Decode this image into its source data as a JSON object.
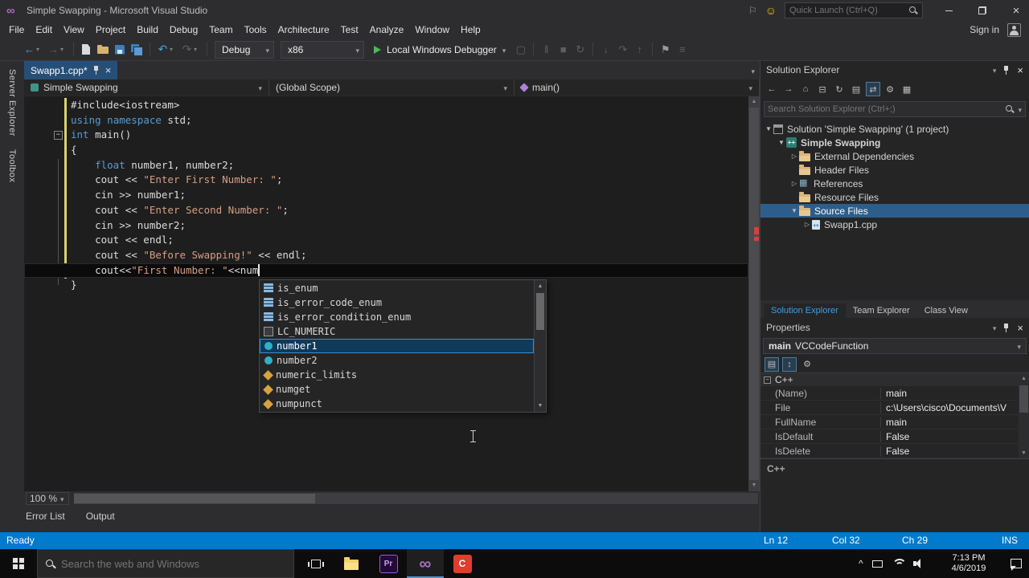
{
  "titlebar": {
    "title": "Simple Swapping - Microsoft Visual Studio",
    "quick_launch": "Quick Launch (Ctrl+Q)"
  },
  "menubar": {
    "items": [
      "File",
      "Edit",
      "View",
      "Project",
      "Build",
      "Debug",
      "Team",
      "Tools",
      "Architecture",
      "Test",
      "Analyze",
      "Window",
      "Help"
    ],
    "sign_in": "Sign in"
  },
  "toolbar": {
    "config": "Debug",
    "platform": "x86",
    "run": "Local Windows Debugger",
    "left_icons": [
      {
        "name": "nav-backward-icon",
        "shape": "back",
        "dd": true
      },
      {
        "name": "nav-forward-icon",
        "shape": "fwd",
        "dd": true
      },
      {
        "sep": true
      },
      {
        "name": "new-file-icon",
        "shape": "newfile"
      },
      {
        "name": "open-file-icon",
        "shape": "openfolder"
      },
      {
        "name": "save-icon",
        "shape": "save"
      },
      {
        "name": "save-all-icon",
        "shape": "saveall"
      },
      {
        "sep": true
      },
      {
        "name": "undo-icon",
        "shape": "undo",
        "dd": true
      },
      {
        "name": "redo-icon",
        "shape": "redo",
        "dd": true
      },
      {
        "sep": true
      }
    ],
    "right_icons": [
      {
        "name": "breakpoints-window-icon",
        "shape": "window"
      },
      {
        "sep": true
      },
      {
        "name": "pause-icon",
        "shape": "pause"
      },
      {
        "name": "stop-icon",
        "shape": "stop"
      },
      {
        "name": "restart-icon",
        "shape": "restart"
      },
      {
        "sep": true
      },
      {
        "name": "step-into-icon",
        "shape": "stepin"
      },
      {
        "name": "step-over-icon",
        "shape": "stepover"
      },
      {
        "name": "step-out-icon",
        "shape": "stepout"
      },
      {
        "sep": true
      },
      {
        "name": "bookmark-icon",
        "shape": "flag"
      },
      {
        "name": "task-list-icon",
        "shape": "list"
      }
    ]
  },
  "side_strip": {
    "tabs": [
      "Server Explorer",
      "Toolbox"
    ]
  },
  "editor": {
    "tab": {
      "label": "Swapp1.cpp*"
    },
    "navbar": {
      "project": "Simple Swapping",
      "scope": "(Global Scope)",
      "member": "main()"
    },
    "zoom": "100 %",
    "panel_tabs": [
      "Error List",
      "Output"
    ],
    "code": [
      {
        "tokens": [
          {
            "c": "pl",
            "t": "#include<iostream>"
          }
        ]
      },
      {
        "tokens": [
          {
            "c": "kw",
            "t": "using"
          },
          {
            "c": "pl",
            "t": " "
          },
          {
            "c": "kw",
            "t": "namespace"
          },
          {
            "c": "pl",
            "t": " std;"
          }
        ]
      },
      {
        "fold": true,
        "tokens": [
          {
            "c": "kw",
            "t": "int"
          },
          {
            "c": "pl",
            "t": " main()"
          }
        ]
      },
      {
        "tokens": [
          {
            "c": "pl",
            "t": "{"
          }
        ]
      },
      {
        "tokens": [
          {
            "c": "pl",
            "t": "    "
          },
          {
            "c": "kw",
            "t": "float"
          },
          {
            "c": "pl",
            "t": " number1, number2;"
          }
        ]
      },
      {
        "tokens": [
          {
            "c": "pl",
            "t": "    cout << "
          },
          {
            "c": "str",
            "t": "\"Enter First Number: \""
          },
          {
            "c": "pl",
            "t": ";"
          }
        ]
      },
      {
        "tokens": [
          {
            "c": "pl",
            "t": "    cin >> number1;"
          }
        ]
      },
      {
        "tokens": [
          {
            "c": "pl",
            "t": "    cout << "
          },
          {
            "c": "str",
            "t": "\"Enter Second Number: \""
          },
          {
            "c": "pl",
            "t": ";"
          }
        ]
      },
      {
        "tokens": [
          {
            "c": "pl",
            "t": "    cin >> number2;"
          }
        ]
      },
      {
        "tokens": [
          {
            "c": "pl",
            "t": "    cout << endl;"
          }
        ]
      },
      {
        "tokens": [
          {
            "c": "pl",
            "t": "    cout << "
          },
          {
            "c": "str",
            "t": "\"Before Swapping!\""
          },
          {
            "c": "pl",
            "t": " << endl;"
          }
        ]
      },
      {
        "current": true,
        "caret": true,
        "tokens": [
          {
            "c": "pl",
            "t": "    cout<<"
          },
          {
            "c": "str",
            "t": "\"First Number: \""
          },
          {
            "c": "pl",
            "t": "<<num"
          }
        ]
      },
      {
        "tokens": [
          {
            "c": "pl",
            "t": "}"
          }
        ]
      }
    ]
  },
  "intellisense": {
    "items": [
      {
        "label": "is_enum",
        "kind": "struct"
      },
      {
        "label": "is_error_code_enum",
        "kind": "struct"
      },
      {
        "label": "is_error_condition_enum",
        "kind": "struct"
      },
      {
        "label": "LC_NUMERIC",
        "kind": "macro"
      },
      {
        "label": "number1",
        "kind": "field",
        "selected": true
      },
      {
        "label": "number2",
        "kind": "field"
      },
      {
        "label": "numeric_limits",
        "kind": "class"
      },
      {
        "label": "numget",
        "kind": "class"
      },
      {
        "label": "numpunct",
        "kind": "class"
      }
    ]
  },
  "solution_explorer": {
    "title": "Solution Explorer",
    "search_placeholder": "Search Solution Explorer (Ctrl+;)",
    "toolbar_icons": [
      {
        "name": "back-icon",
        "glyph": "←"
      },
      {
        "name": "forward-icon",
        "glyph": "→"
      },
      {
        "name": "home-icon",
        "glyph": "⌂"
      },
      {
        "name": "collapse-all-icon",
        "glyph": "⊟"
      },
      {
        "name": "refresh-icon",
        "glyph": "↻"
      },
      {
        "name": "show-all-files-icon",
        "glyph": "▤"
      },
      {
        "name": "sync-active-document-icon",
        "glyph": "⇄",
        "boxed": true
      },
      {
        "name": "properties-icon",
        "glyph": "⚙"
      },
      {
        "name": "preview-icon",
        "glyph": "▦"
      }
    ],
    "tree": [
      {
        "label": "Solution 'Simple Swapping' (1 project)",
        "level": 0,
        "arrow": "expanded",
        "icon": "solution"
      },
      {
        "label": "Simple Swapping",
        "level": 1,
        "arrow": "expanded",
        "icon": "cpp-project",
        "bold": true
      },
      {
        "label": "External Dependencies",
        "level": 2,
        "arrow": "collapsed",
        "icon": "folder"
      },
      {
        "label": "Header Files",
        "level": 2,
        "arrow": "none",
        "icon": "folder"
      },
      {
        "label": "References",
        "level": 2,
        "arrow": "collapsed",
        "icon": "references"
      },
      {
        "label": "Resource Files",
        "level": 2,
        "arrow": "none",
        "icon": "folder"
      },
      {
        "label": "Source Files",
        "level": 2,
        "arrow": "expanded",
        "icon": "folder",
        "selected": true
      },
      {
        "label": "Swapp1.cpp",
        "level": 3,
        "arrow": "collapsed",
        "icon": "cpp-file"
      }
    ],
    "bottom_tabs": [
      {
        "label": "Solution Explorer",
        "active": true
      },
      {
        "label": "Team Explorer"
      },
      {
        "label": "Class View"
      }
    ]
  },
  "properties": {
    "title": "Properties",
    "object_name": "main",
    "object_type": "VCCodeFunction",
    "toolbar_icons": [
      {
        "name": "categorized-icon",
        "glyph": "▤",
        "boxed": true
      },
      {
        "name": "alphabetical-icon",
        "glyph": "↕",
        "boxed": true
      },
      {
        "name": "property-pages-icon",
        "glyph": "⚙"
      }
    ],
    "category": "C++",
    "rows": [
      {
        "name": "(Name)",
        "value": "main"
      },
      {
        "name": "File",
        "value": "c:\\Users\\cisco\\Documents\\V"
      },
      {
        "name": "FullName",
        "value": "main"
      },
      {
        "name": "IsDefault",
        "value": "False"
      },
      {
        "name": "IsDelete",
        "value": "False"
      }
    ],
    "description_title": "C++"
  },
  "statusbar": {
    "ready": "Ready",
    "line": "Ln 12",
    "column": "Col 32",
    "character": "Ch 29",
    "mode": "INS"
  },
  "taskbar": {
    "search_placeholder": "Search the web and Windows",
    "apps": [
      {
        "name": "file-explorer",
        "kind": "explorer"
      },
      {
        "name": "premiere-pro",
        "kind": "pr",
        "glyph": "Pr"
      },
      {
        "name": "visual-studio",
        "kind": "vs",
        "glyph": "∞",
        "active": true
      },
      {
        "name": "screen-recorder",
        "kind": "red",
        "glyph": "C"
      }
    ],
    "time": "7:13 PM",
    "date": "4/6/2019"
  }
}
